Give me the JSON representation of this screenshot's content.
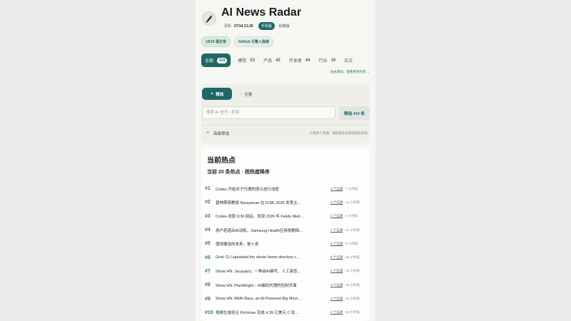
{
  "app": {
    "title": "AI News Radar",
    "updated_label": "更新",
    "updated_time": "07/14 21:29",
    "mode_mobile": "手机版",
    "mode_classic": "经典版"
  },
  "badges": {
    "status": "19/19 源正常",
    "github": "GitHub 引擎入指南"
  },
  "tabs": [
    {
      "label": "全部",
      "count": "410"
    },
    {
      "label": "模型",
      "count": "53"
    },
    {
      "label": "产品",
      "count": "42"
    },
    {
      "label": "开发者",
      "count": "44"
    },
    {
      "label": "行业",
      "count": "16"
    },
    {
      "label": "论文",
      "count": ""
    }
  ],
  "tab_hint": "左右滑动，查看更多栏目 →",
  "filter": {
    "curated_label": "精选",
    "all_label": "全量",
    "search_placeholder": "搜索 AI 信号 / 来源",
    "apply_label": "精选 410 条",
    "advanced_label": "高级筛选",
    "advanced_note": "只看某个来源、或排查失效源就展开高级"
  },
  "hot": {
    "title": "当前热点",
    "subtitle": "当前 20 条热点 · 按热度降序",
    "items": [
      {
        "rank": "#1",
        "text": "Codex 开始对子代理的提示进行加密",
        "sources": "3 个信源",
        "time": "· 7 小时前"
      },
      {
        "rank": "#2",
        "text": "普林斯顿教授 Narayanan 在 ICML 2026 发表主...",
        "sources": "3 个信源",
        "time": "· 12 小时前"
      },
      {
        "rank": "#3",
        "text": "Codex 攻取 ICM 网站。发现 2026 年 Fields Med...",
        "sources": "2 个信源",
        "time": "· 6 小时前"
      },
      {
        "rank": "#4",
        "text": "用户若退出AI训练，Samsung Health应用将删除...",
        "sources": "4 个信源",
        "time": "· 21 小时前"
      },
      {
        "rank": "#5",
        "text": "值得建设的未来，是人类",
        "sources": "3 个信源",
        "time": "· 6 小时前"
      },
      {
        "rank": "#6",
        "text": "Grok CLI uploaded the whole home directory t...",
        "sources": "5 个信源",
        "time": "· 26 小时前"
      },
      {
        "rank": "#7",
        "text": "Show HN: Jacquard，一种由AI编写、人工审查...",
        "sources": "3 个信源",
        "time": "· 22 小时前"
      },
      {
        "rank": "#8",
        "text": "Show HN: PlanWright – AI编码代理的控制平面",
        "sources": "3 个信源",
        "time": "· 23 小时前"
      },
      {
        "rank": "#9",
        "text": "Show HN: BillAI Bass, an AI-Powered Big Mout...",
        "sources": "3 个信源",
        "time": "· 24 小时前"
      },
      {
        "rank": "#10",
        "text": "视频生成创企 PixVerse 完成 4.39 亿美元 C 轮...",
        "sources": "2 个信源",
        "time": "· 19 小时前"
      }
    ]
  }
}
